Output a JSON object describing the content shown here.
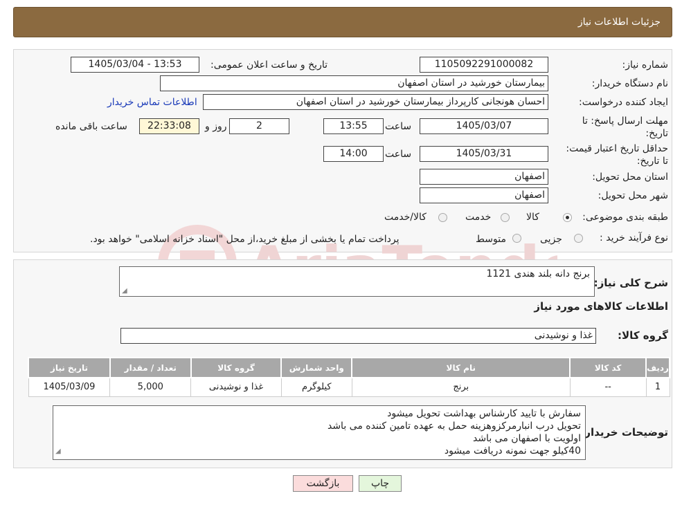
{
  "header": {
    "title": "جزئیات اطلاعات نیاز"
  },
  "form": {
    "need_number_label": "شماره نیاز:",
    "need_number": "1105092291000082",
    "announce_label": "تاریخ و ساعت اعلان عمومی:",
    "announce_value": "1405/03/04 - 13:53",
    "buyer_org_label": "نام دستگاه خریدار:",
    "buyer_org": "بیمارستان خورشید در استان اصفهان",
    "creator_label": "ایجاد کننده درخواست:",
    "creator": "احسان هونجانی کارپرداز بیمارستان خورشید در استان اصفهان",
    "contact_link": "اطلاعات تماس خریدار",
    "deadline_label": "مهلت ارسال پاسخ: تا تاریخ:",
    "deadline_date": "1405/03/07",
    "time_label": "ساعت",
    "deadline_time": "13:55",
    "days_value": "2",
    "days_label": "روز و",
    "remaining_value": "22:33:08",
    "remaining_label": "ساعت باقی مانده",
    "validity_label": "حداقل تاریخ اعتبار قیمت: تا تاریخ:",
    "validity_date": "1405/03/31",
    "validity_time": "14:00",
    "province_label": "استان محل تحویل:",
    "province": "اصفهان",
    "city_label": "شهر محل تحویل:",
    "city": "اصفهان",
    "category_label": "طبقه بندی موضوعی:",
    "category_options": [
      "کالا",
      "خدمت",
      "کالا/خدمت"
    ],
    "category_selected": "کالا",
    "process_label": "نوع فرآیند خرید :",
    "process_options": [
      "جزیی",
      "متوسط"
    ],
    "process_note": "پرداخت تمام یا بخشی از مبلغ خرید،از محل \"اسناد خزانه اسلامی\" خواهد بود."
  },
  "watermark": {
    "text": "AriaTender.neT"
  },
  "details": {
    "summary_label": "شرح کلی نیاز:",
    "summary_value": "برنج دانه بلند هندی 1121",
    "goods_info_title": "اطلاعات کالاهای مورد نیاز",
    "goods_group_label": "گروه کالا:",
    "goods_group_value": "غذا و نوشیدنی",
    "table": {
      "headers": [
        "ردیف",
        "کد کالا",
        "نام کالا",
        "واحد شمارش",
        "گروه کالا",
        "تعداد / مقدار",
        "تاریخ نیاز"
      ],
      "rows": [
        [
          "1",
          "--",
          "برنج",
          "کیلوگرم",
          "غذا و نوشیدنی",
          "5,000",
          "1405/03/09"
        ]
      ]
    },
    "buyer_notes_label": "توضیحات خریدار:",
    "buyer_notes": [
      "سفارش با تایید کارشناس بهداشت تحویل میشود",
      "تحویل درب انبارمرکزوهزینه حمل به عهده تامین کننده می باشد",
      "اولویت با اصفهان می باشد",
      "40کیلو جهت نمونه دریافت میشود"
    ]
  },
  "buttons": {
    "back": "بازگشت",
    "print": "چاپ"
  },
  "colors": {
    "header_bg": "#8b6a40",
    "link": "#1a3ab8",
    "table_header": "#a8a8a8"
  }
}
